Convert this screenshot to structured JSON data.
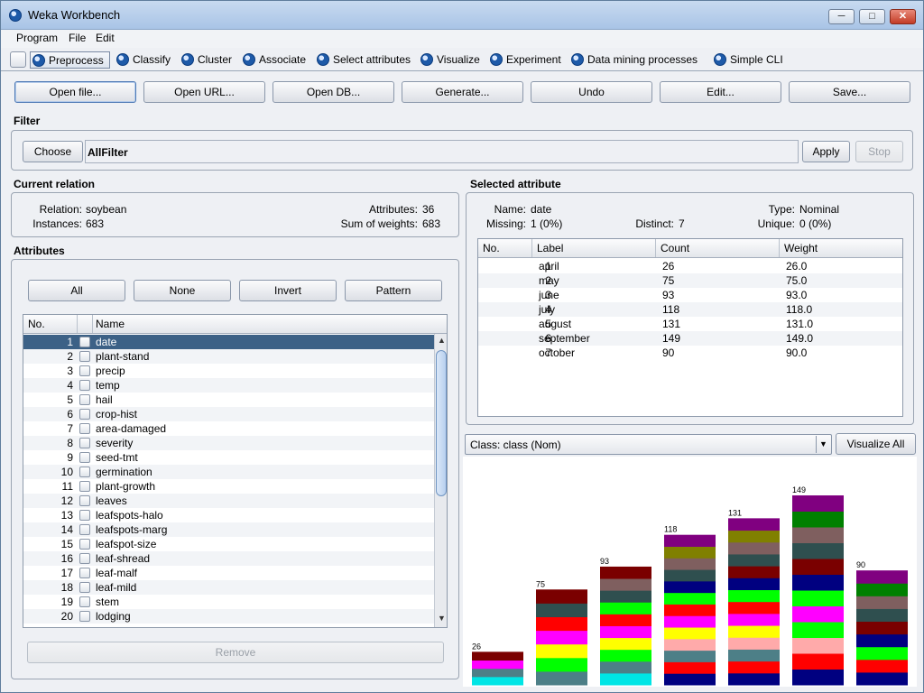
{
  "window": {
    "title": "Weka Workbench"
  },
  "menu": [
    "Program",
    "File",
    "Edit"
  ],
  "tabs": [
    "Preprocess",
    "Classify",
    "Cluster",
    "Associate",
    "Select attributes",
    "Visualize",
    "Experiment",
    "Data mining processes",
    "Simple CLI"
  ],
  "toolbar": [
    "Open file...",
    "Open URL...",
    "Open DB...",
    "Generate...",
    "Undo",
    "Edit...",
    "Save..."
  ],
  "filter": {
    "label": "Filter",
    "choose": "Choose",
    "value": "AllFilter",
    "apply": "Apply",
    "stop": "Stop"
  },
  "relation": {
    "label": "Current relation",
    "relation_key": "Relation:",
    "relation_val": "soybean",
    "instances_key": "Instances:",
    "instances_val": "683",
    "attributes_key": "Attributes:",
    "attributes_val": "36",
    "weights_key": "Sum of weights:",
    "weights_val": "683"
  },
  "attributes": {
    "label": "Attributes",
    "buttons": [
      "All",
      "None",
      "Invert",
      "Pattern"
    ],
    "col_no": "No.",
    "col_name": "Name",
    "rows": [
      "date",
      "plant-stand",
      "precip",
      "temp",
      "hail",
      "crop-hist",
      "area-damaged",
      "severity",
      "seed-tmt",
      "germination",
      "plant-growth",
      "leaves",
      "leafspots-halo",
      "leafspots-marg",
      "leafspot-size",
      "leaf-shread",
      "leaf-malf",
      "leaf-mild",
      "stem",
      "lodging"
    ],
    "selected_index": 0,
    "remove": "Remove"
  },
  "selected": {
    "label": "Selected attribute",
    "name_key": "Name:",
    "name_val": "date",
    "type_key": "Type:",
    "type_val": "Nominal",
    "missing_key": "Missing:",
    "missing_val": "1 (0%)",
    "distinct_key": "Distinct:",
    "distinct_val": "7",
    "unique_key": "Unique:",
    "unique_val": "0 (0%)",
    "columns": [
      "No.",
      "Label",
      "Count",
      "Weight"
    ],
    "rows": [
      {
        "no": "1",
        "label": "april",
        "count": "26",
        "weight": "26.0"
      },
      {
        "no": "2",
        "label": "may",
        "count": "75",
        "weight": "75.0"
      },
      {
        "no": "3",
        "label": "june",
        "count": "93",
        "weight": "93.0"
      },
      {
        "no": "4",
        "label": "july",
        "count": "118",
        "weight": "118.0"
      },
      {
        "no": "5",
        "label": "august",
        "count": "131",
        "weight": "131.0"
      },
      {
        "no": "6",
        "label": "september",
        "count": "149",
        "weight": "149.0"
      },
      {
        "no": "7",
        "label": "october",
        "count": "90",
        "weight": "90.0"
      }
    ]
  },
  "class_select": {
    "value": "Class: class (Nom)",
    "visualize_all": "Visualize All"
  },
  "colors": {
    "selection": "#3c6186",
    "palette": [
      "#00e5e5",
      "#4d7f87",
      "#ffaaaa",
      "#ff0000",
      "#ff00ff",
      "#ffff00",
      "#00ff00",
      "#2f4f4f",
      "#000080",
      "#7a0000",
      "#7f5f5f",
      "#008000",
      "#808000",
      "#800080"
    ]
  },
  "chart_data": {
    "type": "bar",
    "categories": [
      "april",
      "may",
      "june",
      "july",
      "august",
      "september",
      "october"
    ],
    "values": [
      26,
      75,
      93,
      118,
      131,
      149,
      90
    ],
    "stack_colors": [
      [
        "#00e5e5",
        "#4d7f87",
        "#ff00ff",
        "#7a0000"
      ],
      [
        "#4d7f87",
        "#00ff00",
        "#ffff00",
        "#ff00ff",
        "#ff0000",
        "#2f4f4f",
        "#7a0000"
      ],
      [
        "#00e5e5",
        "#4d7f87",
        "#00ff00",
        "#ffff00",
        "#ff00ff",
        "#ff0000",
        "#00ff00",
        "#2f4f4f",
        "#7f5f5f",
        "#7a0000"
      ],
      [
        "#000080",
        "#ff0000",
        "#4d7f87",
        "#ffaaaa",
        "#ffff00",
        "#ff00ff",
        "#ff0000",
        "#00ff00",
        "#000080",
        "#2f4f4f",
        "#7f5f5f",
        "#808000",
        "#800080"
      ],
      [
        "#000080",
        "#ff0000",
        "#4d7f87",
        "#ffaaaa",
        "#ffff00",
        "#ff00ff",
        "#ff0000",
        "#00ff00",
        "#000080",
        "#7a0000",
        "#2f4f4f",
        "#7f5f5f",
        "#808000",
        "#800080"
      ],
      [
        "#000080",
        "#ff0000",
        "#ffaaaa",
        "#00ff00",
        "#ff00ff",
        "#00ff00",
        "#000080",
        "#7a0000",
        "#2f4f4f",
        "#7f5f5f",
        "#008000",
        "#800080"
      ],
      [
        "#000080",
        "#ff0000",
        "#00ff00",
        "#000080",
        "#7a0000",
        "#2f4f4f",
        "#7f5f5f",
        "#008000",
        "#800080"
      ]
    ],
    "ylim": [
      0,
      149
    ],
    "grid": false
  }
}
